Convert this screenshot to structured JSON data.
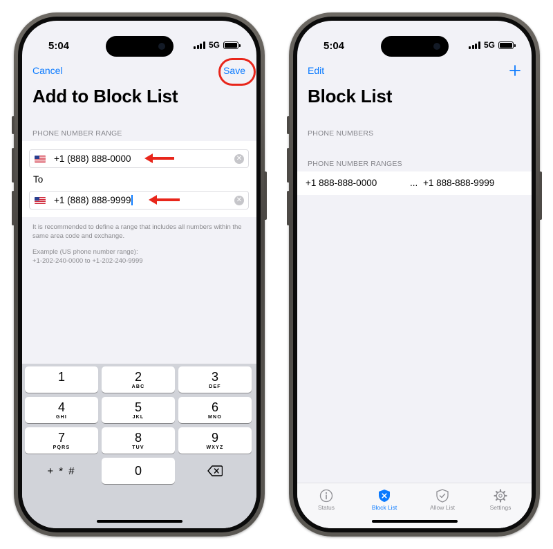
{
  "status_bar": {
    "time": "5:04",
    "network": "5G"
  },
  "add_screen": {
    "cancel_label": "Cancel",
    "save_label": "Save",
    "title": "Add to Block List",
    "section_header": "PHONE NUMBER RANGE",
    "from_value": "+1 (888) 888-0000",
    "to_label": "To",
    "to_value": "+1 (888) 888-9999",
    "note": "It is recommended to define a range that includes all numbers within the same area code and exchange.",
    "example_heading": "Example (US phone number range):",
    "example_value": "+1-202-240-0000 to +1-202-240-9999"
  },
  "keypad": {
    "keys": [
      {
        "digit": "1",
        "letters": ""
      },
      {
        "digit": "2",
        "letters": "ABC"
      },
      {
        "digit": "3",
        "letters": "DEF"
      },
      {
        "digit": "4",
        "letters": "GHI"
      },
      {
        "digit": "5",
        "letters": "JKL"
      },
      {
        "digit": "6",
        "letters": "MNO"
      },
      {
        "digit": "7",
        "letters": "PQRS"
      },
      {
        "digit": "8",
        "letters": "TUV"
      },
      {
        "digit": "9",
        "letters": "WXYZ"
      }
    ],
    "symbols_label": "+ * #",
    "zero": "0"
  },
  "block_list_screen": {
    "edit_label": "Edit",
    "add_icon": "plus-icon",
    "title": "Block List",
    "numbers_header": "PHONE NUMBERS",
    "ranges_header": "PHONE NUMBER RANGES",
    "range_start": "+1 888-888-0000",
    "range_separator": "...",
    "range_end": "+1 888-888-9999"
  },
  "tabbar": {
    "tabs": [
      {
        "label": "Status",
        "icon": "info-icon",
        "active": false
      },
      {
        "label": "Block List",
        "icon": "shield-x-icon",
        "active": true
      },
      {
        "label": "Allow List",
        "icon": "shield-check-icon",
        "active": false
      },
      {
        "label": "Settings",
        "icon": "gear-icon",
        "active": false
      }
    ]
  },
  "colors": {
    "accent": "#0a7aff",
    "annotation": "#e8261b",
    "grouped_background": "#f2f2f7",
    "keypad_background": "#d1d3d9"
  }
}
